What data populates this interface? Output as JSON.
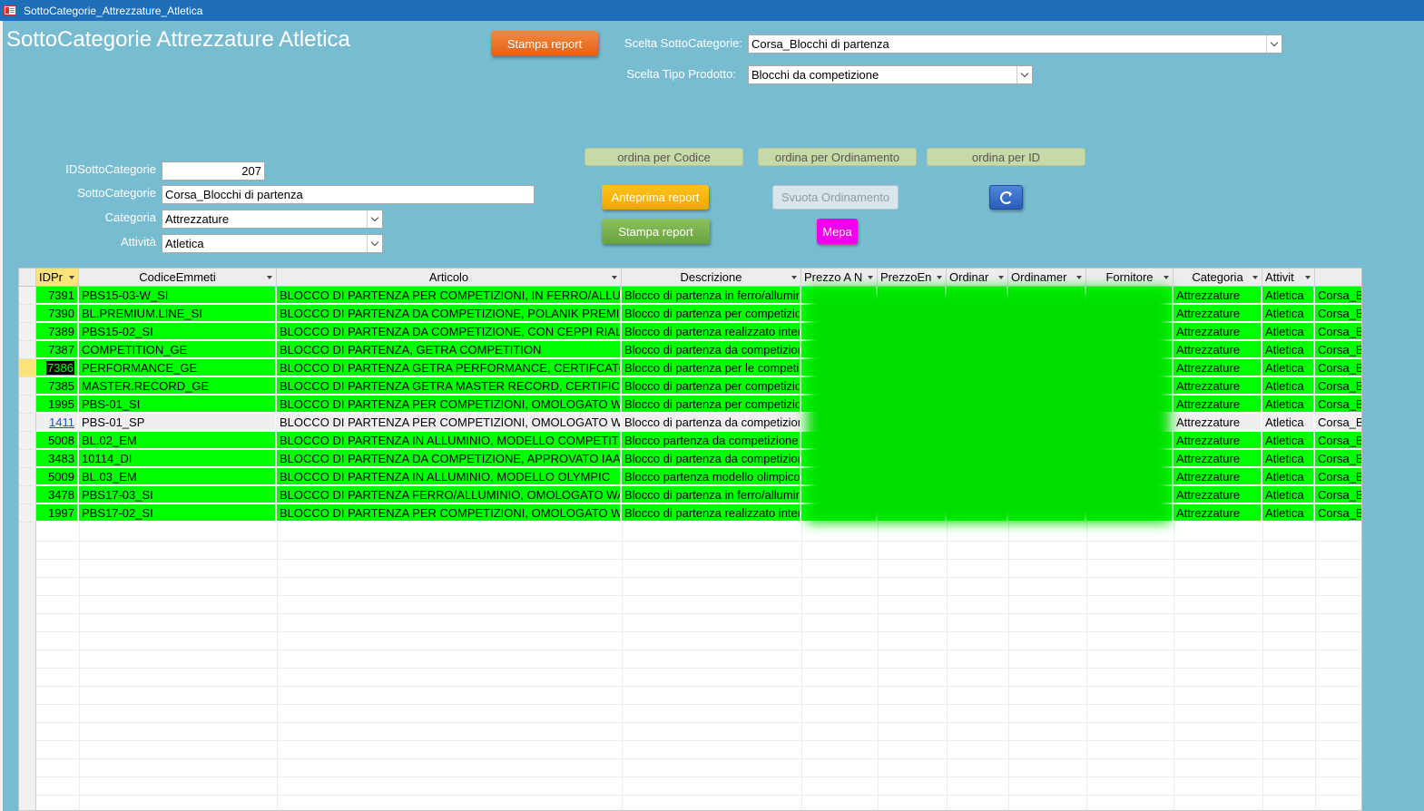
{
  "window": {
    "title": "SottoCategorie_Attrezzature_Atletica"
  },
  "form": {
    "title": "SottoCategorie Attrezzature Atletica",
    "stampa_report_top": "Stampa report",
    "scelta_sottocategorie_label": "Scelta SottoCategorie:",
    "scelta_sottocategorie_value": "Corsa_Blocchi di partenza",
    "scelta_tipo_label": "Scelta Tipo Prodotto:",
    "scelta_tipo_value": "Blocchi da competizione",
    "sort_buttons": [
      "ordina per Codice",
      "ordina per Ordinamento",
      "ordina per ID"
    ],
    "anteprima_report": "Anteprima report",
    "svuota_ordinamento": "Svuota Ordinamento",
    "stampa_report": "Stampa report",
    "mepa": "Mepa",
    "fields": {
      "id_label": "IDSottoCategorie",
      "id_value": "207",
      "sotto_label": "SottoCategorie",
      "sotto_value": "Corsa_Blocchi di partenza",
      "categoria_label": "Categoria",
      "categoria_value": "Attrezzature",
      "attivita_label": "Attività",
      "attivita_value": "Atletica"
    }
  },
  "grid": {
    "columns": [
      "IDPr",
      "CodiceEmmeti",
      "Articolo",
      "Descrizione",
      "Prezzo A N",
      "PrezzoEn",
      "Ordinar",
      "Ordinamer",
      "Fornitore",
      "Categoria",
      "Attivit",
      ""
    ],
    "rows": [
      {
        "id": "7391",
        "codice": "PBS15-03-W_SI",
        "articolo": "BLOCCO DI PARTENZA PER COMPETIZIONI, IN FERRO/ALLUMINIO",
        "descrizione": "Blocco di partenza in ferro/alluminio",
        "categoria": "Attrezzature",
        "attivita": "Atletica",
        "sotto": "Corsa_B"
      },
      {
        "id": "7390",
        "codice": "BL.PREMIUM.LINE_SI",
        "articolo": "BLOCCO DI PARTENZA DA COMPETIZIONE, POLANIK PREMIUM",
        "descrizione": "Blocco di partenza per competizioni",
        "categoria": "Attrezzature",
        "attivita": "Atletica",
        "sotto": "Corsa_B"
      },
      {
        "id": "7389",
        "codice": "PBS15-02_SI",
        "articolo": "BLOCCO DI PARTENZA DA COMPETIZIONE, CON CEPPI RIALZATI",
        "descrizione": "Blocco di partenza realizzato interamente",
        "categoria": "Attrezzature",
        "attivita": "Atletica",
        "sotto": "Corsa_B"
      },
      {
        "id": "7387",
        "codice": "COMPETITION_GE",
        "articolo": "BLOCCO DI PARTENZA, GETRA COMPETITION",
        "descrizione": "Blocco di partenza da competizione",
        "categoria": "Attrezzature",
        "attivita": "Atletica",
        "sotto": "Corsa_B"
      },
      {
        "id": "7386",
        "codice": "PERFORMANCE_GE",
        "articolo": "BLOCCO DI PARTENZA GETRA PERFORMANCE, CERTIFCATO WA",
        "descrizione": "Blocco di partenza per le competizioni",
        "categoria": "Attrezzature",
        "attivita": "Atletica",
        "sotto": "Corsa_B"
      },
      {
        "id": "7385",
        "codice": "MASTER.RECORD_GE",
        "articolo": "BLOCCO DI PARTENZA GETRA MASTER RECORD, CERTIFICATO",
        "descrizione": "Blocco di partenza per competizioni",
        "categoria": "Attrezzature",
        "attivita": "Atletica",
        "sotto": "Corsa_B"
      },
      {
        "id": "1995",
        "codice": "PBS-01_SI",
        "articolo": "BLOCCO DI PARTENZA PER COMPETIZIONI, OMOLOGATO WA,",
        "descrizione": "Blocco di partenza per competizioni",
        "categoria": "Attrezzature",
        "attivita": "Atletica",
        "sotto": "Corsa_B"
      },
      {
        "id": "1411",
        "codice": "PBS-01_SP",
        "articolo": "BLOCCO DI PARTENZA PER COMPETIZIONI, OMOLOGATO WA,",
        "descrizione": "Blocco di partenza da competizione",
        "categoria": "Attrezzature",
        "attivita": "Atletica",
        "sotto": "Corsa_B"
      },
      {
        "id": "5008",
        "codice": "BL.02_EM",
        "articolo": "BLOCCO DI PARTENZA IN ALLUMINIO, MODELLO COMPETITION",
        "descrizione": "Blocco partenza da competizione",
        "categoria": "Attrezzature",
        "attivita": "Atletica",
        "sotto": "Corsa_B"
      },
      {
        "id": "3483",
        "codice": "10114_DI",
        "articolo": "BLOCCO DI PARTENZA DA COMPETIZIONE, APPROVATO IAAF",
        "descrizione": "Blocco di partenza da competizione",
        "categoria": "Attrezzature",
        "attivita": "Atletica",
        "sotto": "Corsa_B"
      },
      {
        "id": "5009",
        "codice": "BL.03_EM",
        "articolo": "BLOCCO DI PARTENZA IN ALLUMINIO, MODELLO OLYMPIC",
        "descrizione": "Blocco partenza modello olimpico",
        "categoria": "Attrezzature",
        "attivita": "Atletica",
        "sotto": "Corsa_B"
      },
      {
        "id": "3478",
        "codice": "PBS17-03_SI",
        "articolo": "BLOCCO DI PARTENZA FERRO/ALLUMINIO, OMOLOGATO WA,",
        "descrizione": "Blocco di partenza in ferro/alluminio",
        "categoria": "Attrezzature",
        "attivita": "Atletica",
        "sotto": "Corsa_B"
      },
      {
        "id": "1997",
        "codice": "PBS17-02_SI",
        "articolo": "BLOCCO DI PARTENZA PER COMPETIZIONI, OMOLOGATO WA,",
        "descrizione": "Blocco di partenza realizzato interamente",
        "categoria": "Attrezzature",
        "attivita": "Atletica",
        "sotto": "Corsa_B"
      }
    ]
  },
  "colors": {
    "background": "#78bcd1",
    "row_highlight": "#00ff00",
    "titlebar": "#1e6fb8"
  }
}
